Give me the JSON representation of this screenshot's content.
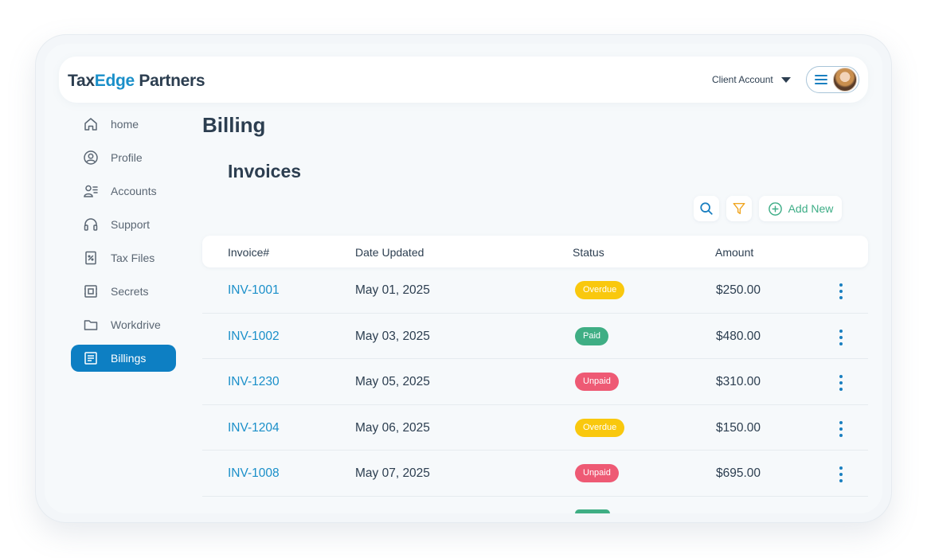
{
  "brand": {
    "part1": "Tax",
    "part2": "Edge",
    "part3": " Partners",
    "accent_color": "#1a8fc9"
  },
  "header": {
    "account_label": "Client Account"
  },
  "sidebar": {
    "items": [
      {
        "label": "home",
        "icon": "home-icon"
      },
      {
        "label": "Profile",
        "icon": "user-circle-icon"
      },
      {
        "label": "Accounts",
        "icon": "accounts-icon"
      },
      {
        "label": "Support",
        "icon": "headphones-icon"
      },
      {
        "label": "Tax Files",
        "icon": "tax-file-icon"
      },
      {
        "label": "Secrets",
        "icon": "vault-icon"
      },
      {
        "label": "Workdrive",
        "icon": "folder-icon"
      },
      {
        "label": "Billings",
        "icon": "billing-icon",
        "active": true
      }
    ],
    "active_color": "#0d7fc3"
  },
  "page": {
    "title": "Billing",
    "section_title": "Invoices"
  },
  "toolbar": {
    "add_label": "Add New"
  },
  "table": {
    "headers": {
      "invoice": "Invoice#",
      "date": "Date Updated",
      "status": "Status",
      "amount": "Amount"
    },
    "rows": [
      {
        "invoice": "INV-1001",
        "date": "May 01, 2025",
        "status": "Overdue",
        "amount": "$250.00"
      },
      {
        "invoice": "INV-1002",
        "date": "May 03, 2025",
        "status": "Paid",
        "amount": "$480.00"
      },
      {
        "invoice": "INV-1230",
        "date": "May 05, 2025",
        "status": "Unpaid",
        "amount": "$310.00"
      },
      {
        "invoice": "INV-1204",
        "date": "May 06, 2025",
        "status": "Overdue",
        "amount": "$150.00"
      },
      {
        "invoice": "INV-1008",
        "date": "May 07, 2025",
        "status": "Unpaid",
        "amount": "$695.00"
      }
    ],
    "status_colors": {
      "Overdue": "#f9c80e",
      "Paid": "#3fae84",
      "Unpaid": "#ee5a74"
    }
  }
}
